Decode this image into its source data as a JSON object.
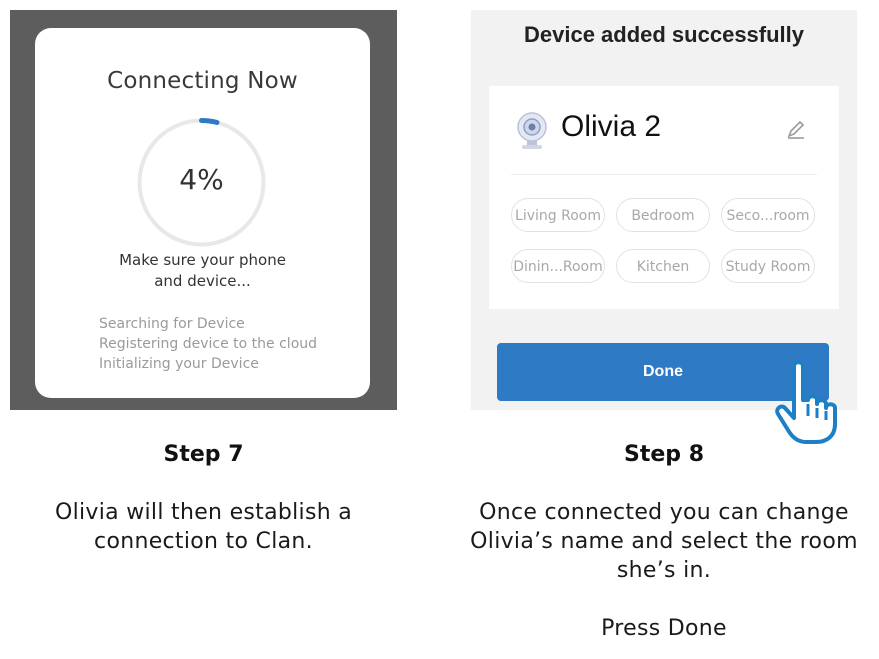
{
  "step7": {
    "screen": {
      "title": "Connecting Now",
      "progress_label": "4%",
      "progress_value": 0.04,
      "message_line1": "Make sure your phone",
      "message_line2": "and device...",
      "status_items": [
        "Searching for Device",
        "Registering device to the cloud",
        "Initializing your Device"
      ]
    },
    "heading": "Step 7",
    "caption_line1": "Olivia will then establish a",
    "caption_line2": "connection to Clan."
  },
  "step8": {
    "screen": {
      "title": "Device added successfully",
      "device_name": "Olivia 2",
      "device_icon": "camera-icon",
      "edit_icon": "pencil-icon",
      "rooms": [
        "Living Room",
        "Bedroom",
        "Seco...room",
        "Dinin...Room",
        "Kitchen",
        "Study Room"
      ],
      "done_label": "Done",
      "pointer_icon": "hand-pointer-icon"
    },
    "heading": "Step 8",
    "caption_line1": "Once connected you can change",
    "caption_line2": "Olivia’s name and select the room",
    "caption_line3": "she’s in.",
    "caption_line4": "Press Done"
  },
  "colors": {
    "progress_accent": "#2e7ac4",
    "done_button": "#2e7ac4",
    "overlay_backdrop": "#5d5d5d"
  }
}
